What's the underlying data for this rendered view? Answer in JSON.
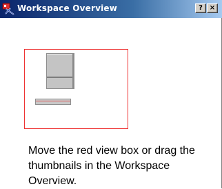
{
  "window": {
    "title": "Workspace Overview",
    "help_button": "?",
    "close_button": "×"
  },
  "icons": {
    "app": "workspace-app-icon",
    "help": "question-mark-icon",
    "close": "close-icon"
  },
  "colors": {
    "titlebar": "#0a246a",
    "view_box": "#ee3333",
    "thumbnail": "#c4c4c4"
  },
  "overview": {
    "instruction": "Move the red view box or drag the thumbnails in the Workspace Overview."
  }
}
